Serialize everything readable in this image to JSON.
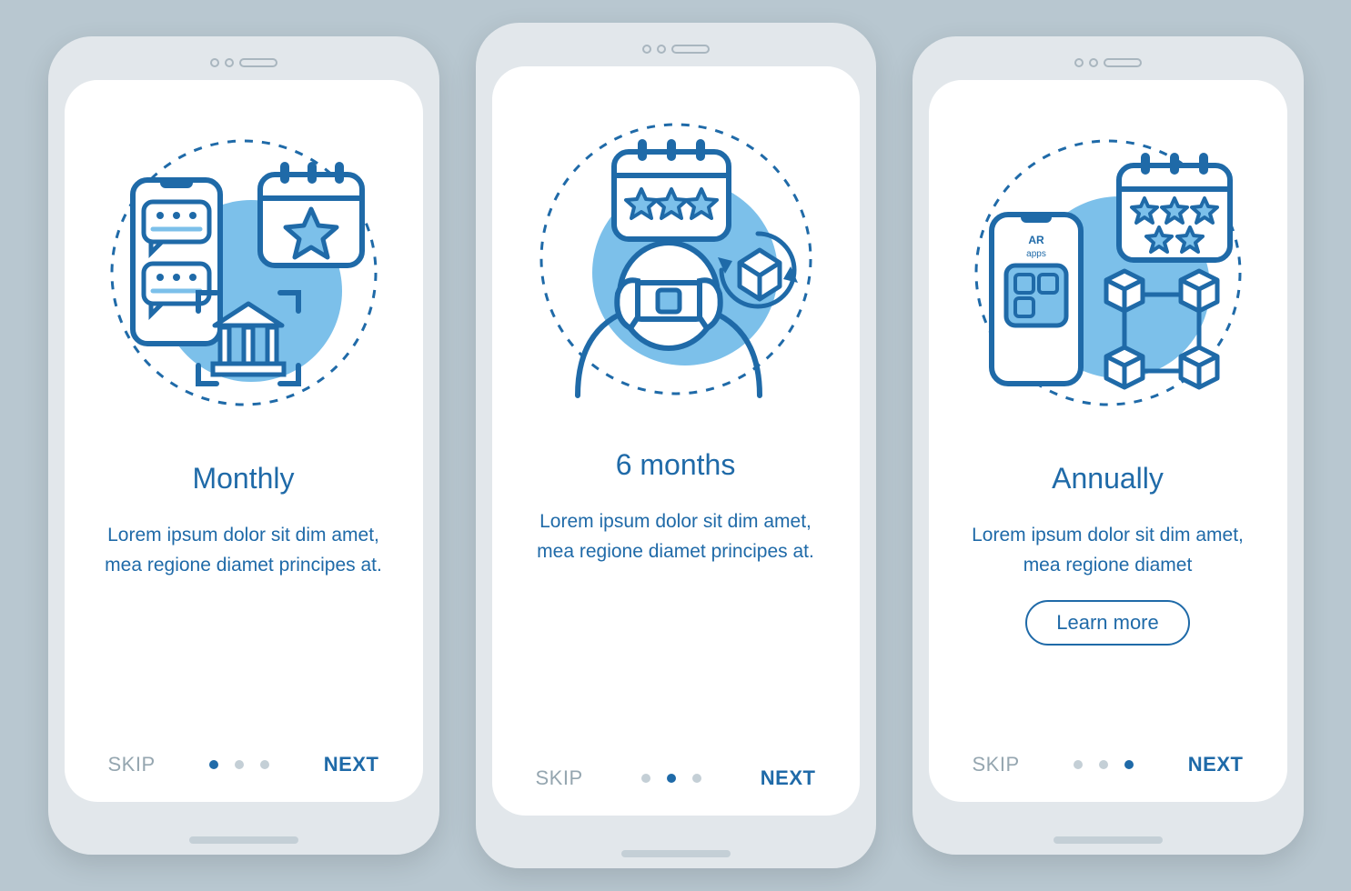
{
  "colors": {
    "primary": "#1f6aa8",
    "accent": "#7cc0ea",
    "muted": "#95a6b0",
    "bg": "#b8c7d0"
  },
  "screens": [
    {
      "title": "Monthly",
      "body": "Lorem ipsum dolor sit dim amet, mea regione diamet principes at.",
      "skip": "SKIP",
      "next": "NEXT",
      "active_dot": 0,
      "has_learn_more": false,
      "illustration": "reviews-bank-calendar"
    },
    {
      "title": "6 months",
      "body": "Lorem ipsum dolor sit dim amet, mea regione diamet principes at.",
      "skip": "SKIP",
      "next": "NEXT",
      "active_dot": 1,
      "has_learn_more": false,
      "illustration": "vr-headset-cube"
    },
    {
      "title": "Annually",
      "body": "Lorem ipsum dolor sit dim amet, mea regione diamet",
      "skip": "SKIP",
      "next": "NEXT",
      "active_dot": 2,
      "has_learn_more": true,
      "learn_more": "Learn more",
      "illustration": "ar-apps-blockchain",
      "ar_title": "AR",
      "ar_subtitle": "apps"
    }
  ]
}
